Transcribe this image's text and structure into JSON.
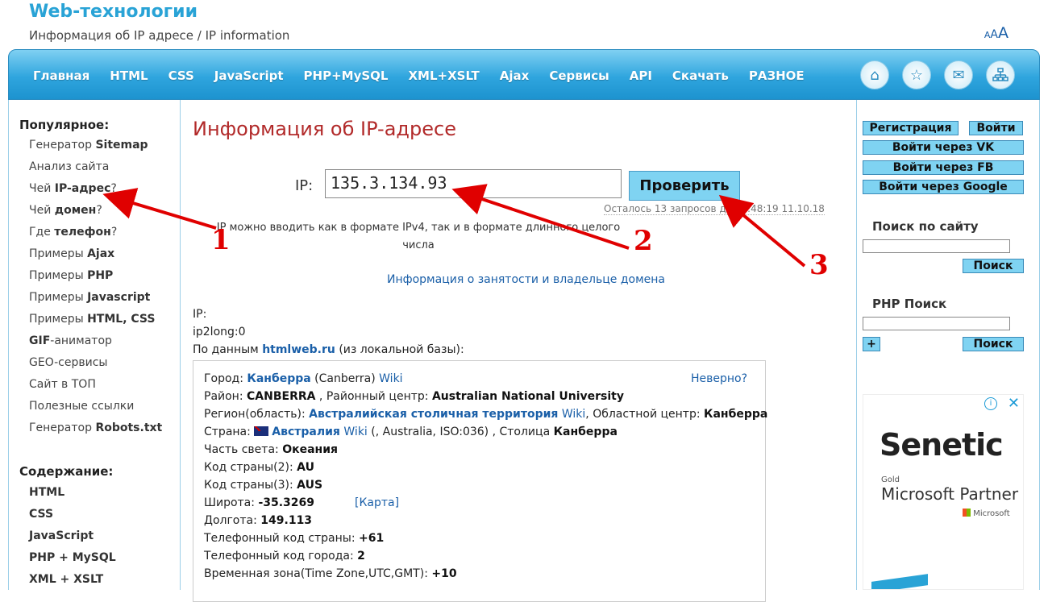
{
  "header": {
    "site_title": "Web-технологии",
    "subtitle": "Информация об IP адресе / IP information",
    "font_small": "A",
    "font_medium": "A",
    "font_large": "A"
  },
  "nav": {
    "items": [
      "Главная",
      "HTML",
      "CSS",
      "JavaScript",
      "PHP+MySQL",
      "XML+XSLT",
      "Ajax",
      "Сервисы",
      "API",
      "Скачать",
      "РАЗНОЕ"
    ],
    "icons": [
      "home-icon",
      "star-icon",
      "mail-icon",
      "sitemap-icon"
    ]
  },
  "left": {
    "popular_title": "Популярное:",
    "popular": [
      {
        "pre": "Генератор ",
        "bold": "Sitemap",
        "post": ""
      },
      {
        "pre": "Анализ сайта",
        "bold": "",
        "post": ""
      },
      {
        "pre": "Чей ",
        "bold": "IP-адрес",
        "post": "?"
      },
      {
        "pre": "Чей ",
        "bold": "домен",
        "post": "?"
      },
      {
        "pre": "Где ",
        "bold": "телефон",
        "post": "?"
      },
      {
        "pre": "Примеры ",
        "bold": "Ajax",
        "post": ""
      },
      {
        "pre": "Примеры ",
        "bold": "PHP",
        "post": ""
      },
      {
        "pre": "Примеры ",
        "bold": "Javascript",
        "post": ""
      },
      {
        "pre": "Примеры ",
        "bold": "HTML, CSS",
        "post": ""
      },
      {
        "pre": "",
        "bold": "GIF",
        "post": "-аниматор"
      },
      {
        "pre": "GEO-сервисы",
        "bold": "",
        "post": ""
      },
      {
        "pre": "Сайт в ТОП",
        "bold": "",
        "post": ""
      },
      {
        "pre": "Полезные ссылки",
        "bold": "",
        "post": ""
      },
      {
        "pre": "Генератор ",
        "bold": "Robots.txt",
        "post": ""
      }
    ],
    "contents_title": "Содержание:",
    "contents": [
      "HTML",
      "CSS",
      "JavaScript",
      "PHP + MySQL",
      "XML + XSLT"
    ]
  },
  "main": {
    "title": "Информация об IP-адресе",
    "ip_label": "IP:",
    "ip_value": "135.3.134.93",
    "check_button": "Проверить",
    "remaining": "Осталось 13 запросов до 10:48:19 11.10.18",
    "ip_note": "IP можно вводить как в формате IPv4, так и в формате длинного целого числа",
    "domain_link": "Информация о занятости и владельце домена",
    "ip_line": "IP:",
    "ip2long": "ip2long:0",
    "source_pre": "По данным ",
    "source_link": "htmlweb.ru",
    "source_post": " (из локальной базы):"
  },
  "info": {
    "wrong": "Неверно?",
    "city_label": "Город: ",
    "city": "Канберра",
    "city_en": " (Canberra) ",
    "wiki": "Wiki",
    "district_label": "Район: ",
    "district": "CANBERRA",
    "district_center_label": " , Районный центр: ",
    "district_center": "Australian National University",
    "region_label": "Регион(область): ",
    "region": "Австралийская столичная территория",
    "region_center_label": ", Областной центр: ",
    "region_center": "Канберра",
    "country_label": "Страна: ",
    "country": "Австралия",
    "country_extra": " (, Australia, ISO:036) , Столица ",
    "capital": "Канберра",
    "continent_label": "Часть света: ",
    "continent": "Океания",
    "code2_label": "Код страны(2): ",
    "code2": "AU",
    "code3_label": "Код страны(3): ",
    "code3": "AUS",
    "lat_label": "Широта: ",
    "lat": "-35.3269",
    "map_link": "[Карта]",
    "lon_label": "Долгота: ",
    "lon": "149.113",
    "phone_country_label": "Телефонный код страны: ",
    "phone_country": "+61",
    "phone_city_label": "Телефонный код города: ",
    "phone_city": "2",
    "tz_label": "Временная зона(Time Zone,UTC,GMT): ",
    "tz": "+10"
  },
  "right": {
    "register": "Регистрация",
    "login": "Войти",
    "login_vk": "Войти через VK",
    "login_fb": "Войти через FB",
    "login_google": "Войти через Google",
    "site_search_title": "Поиск по сайту",
    "search_button": "Поиск",
    "php_search_title": "PHP Поиск",
    "plus": "+",
    "php_search_button": "Поиск"
  },
  "ad": {
    "brand": "Senetic",
    "gold": "Gold",
    "partner": "Microsoft Partner",
    "ms": "Microsoft",
    "info": "i",
    "close": "✕"
  },
  "annotations": [
    "1",
    "2",
    "3"
  ],
  "colors": {
    "accent": "#29a3d6",
    "title_red": "#b22a2a",
    "link": "#1a5fa8",
    "annotation": "#e00000"
  }
}
